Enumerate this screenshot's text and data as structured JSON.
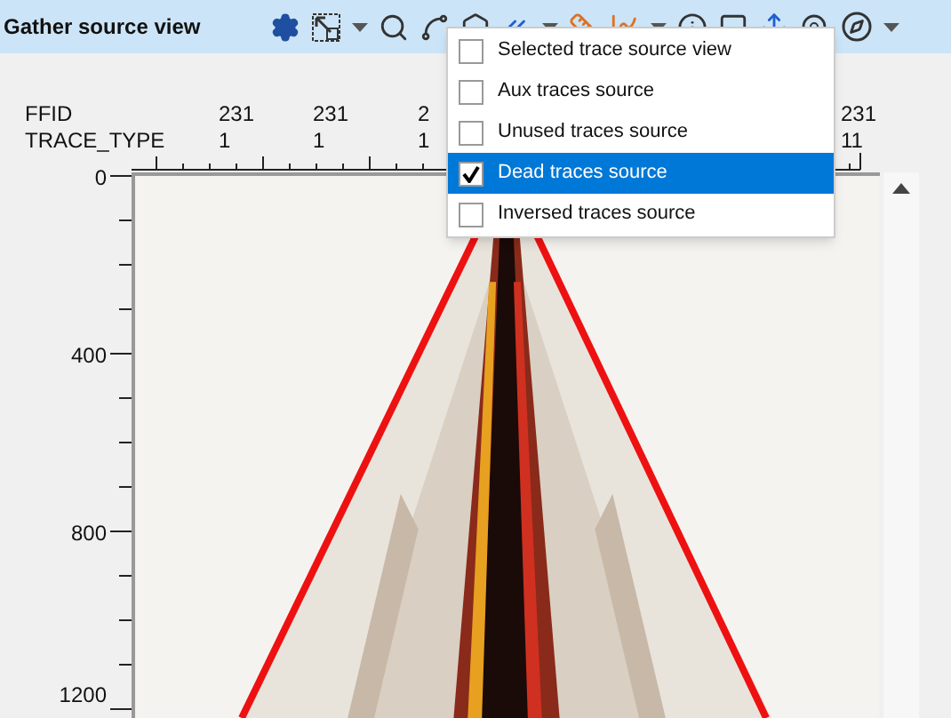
{
  "title": "Gather source view",
  "header_rows": [
    "FFID",
    "TRACE_TYPE"
  ],
  "columns": [
    {
      "ffid": "231",
      "trace_type": "1"
    },
    {
      "ffid": "231",
      "trace_type": "1"
    },
    {
      "ffid": "2",
      "trace_type": "1"
    },
    {
      "ffid": "231",
      "trace_type": "11"
    }
  ],
  "y_axis": [
    "0",
    "400",
    "800",
    "1200"
  ],
  "menu": [
    {
      "label": "Selected trace source view",
      "checked": false,
      "selected": false
    },
    {
      "label": "Aux traces source",
      "checked": false,
      "selected": false
    },
    {
      "label": "Unused traces source",
      "checked": false,
      "selected": false
    },
    {
      "label": "Dead traces source",
      "checked": true,
      "selected": true
    },
    {
      "label": "Inversed traces source",
      "checked": false,
      "selected": false
    }
  ]
}
